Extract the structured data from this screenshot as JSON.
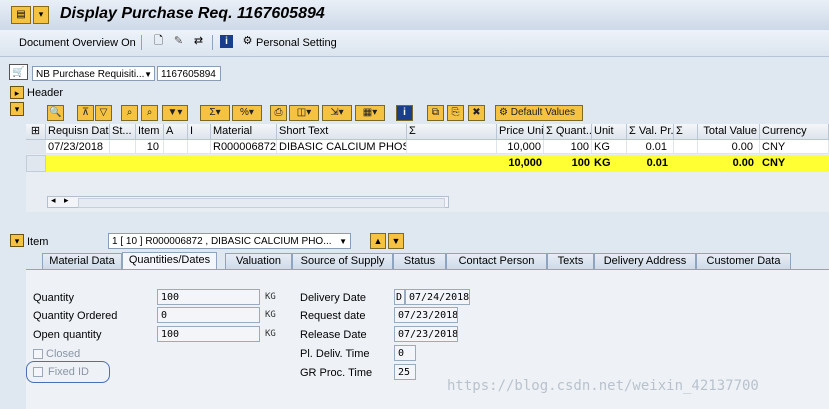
{
  "window": {
    "title": "Display Purchase Req. 1167605894"
  },
  "app_toolbar": {
    "document_overview_label": "Document Overview On",
    "personal_setting_label": "Personal Setting"
  },
  "doc": {
    "type_value": "NB Purchase Requisiti...",
    "number_value": "1167605894",
    "header_label": "Header"
  },
  "grid_toolbar": {
    "default_values_label": "Default Values"
  },
  "table": {
    "headers": [
      "Requisn Date",
      "St...",
      "Item",
      "A",
      "I",
      "Material",
      "Short Text",
      "Σ",
      "Price Unit",
      "Σ Quant...",
      "Unit",
      "Σ Val. Pr...",
      "Σ",
      "Total Value",
      "Currency"
    ],
    "row": {
      "date": "07/23/2018",
      "item": "10",
      "material": "R000006872",
      "short_text": "DIBASIC CALCIUM PHOSP...",
      "price_unit": "10,000",
      "quantity": "100",
      "unit": "KG",
      "val_price": "0.01",
      "total_value": "0.00",
      "currency": "CNY"
    },
    "total_row": {
      "price_unit": "10,000",
      "quantity": "100",
      "unit": "KG",
      "val_price": "0.01",
      "total_value": "0.00",
      "currency": "CNY"
    }
  },
  "item": {
    "label": "Item",
    "selector_value": "1 [ 10 ] R000006872 , DIBASIC CALCIUM PHO..."
  },
  "tabs": [
    "Material Data",
    "Quantities/Dates",
    "Valuation",
    "Source of Supply",
    "Status",
    "Contact Person",
    "Texts",
    "Delivery Address",
    "Customer Data"
  ],
  "quantities": {
    "quantity_label": "Quantity",
    "quantity_value": "100",
    "ordered_label": "Quantity Ordered",
    "ordered_value": "0",
    "open_label": "Open quantity",
    "open_value": "100",
    "unit": "KG",
    "closed_label": "Closed",
    "fixed_id_label": "Fixed ID"
  },
  "dates": {
    "delivery_label": "Delivery Date",
    "delivery_prefix": "D",
    "delivery_value": "07/24/2018",
    "request_label": "Request date",
    "request_value": "07/23/2018",
    "release_label": "Release Date",
    "release_value": "07/23/2018",
    "pl_deliv_label": "Pl. Deliv. Time",
    "pl_deliv_value": "0",
    "gr_proc_label": "GR Proc. Time",
    "gr_proc_value": "25"
  },
  "watermark": "https://blog.csdn.net/weixin_42137700",
  "colors": {
    "total_row": "#ffff33",
    "icon_yellow": "#f5c242",
    "focus_ring": "#4a6fb5"
  }
}
